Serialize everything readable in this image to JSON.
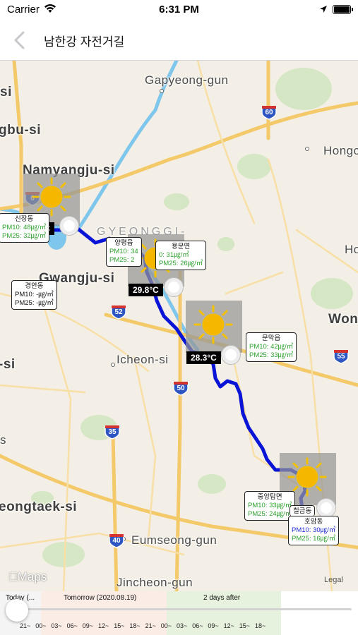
{
  "status_bar": {
    "carrier": "Carrier",
    "time": "6:31 PM"
  },
  "nav": {
    "title": "남한강 자전거길"
  },
  "map": {
    "places": {
      "gapyeong": "Gapyeong-gun",
      "uijeongbu": "gbu-si",
      "hongcheon": "Hongcheo",
      "namyangju": "Namyangju-si",
      "gyeonggi": "GYEONGGI-",
      "gwangju": "Gwangju-si",
      "won": "Won",
      "ho": "Ho",
      "si_left": "-si",
      "icheon": "Icheon-si",
      "pyeongtaek": "eongtaek-si",
      "eumseong": "Eumseong-gun",
      "jincheon": "Jincheon-gun",
      "si_top": "si",
      "s_left": "s"
    },
    "highways": [
      "60",
      "6",
      "52",
      "55",
      "50",
      "35",
      "40"
    ],
    "temps": [
      "29.8°C",
      "28.3°C",
      "°C"
    ],
    "stations": [
      {
        "name": "신장동",
        "pm10": "PM10: 48㎍/㎥",
        "pm25": "PM25: 32㎍/㎥"
      },
      {
        "name": "양평읍",
        "pm10": "PM10: 34",
        "pm25": "PM25: 2"
      },
      {
        "name": "용문면",
        "pm10": "0: 31㎍/㎥",
        "pm25": "PM25: 26㎍/㎥"
      },
      {
        "name": "경안동",
        "pm10": "PM10: -㎍/㎥",
        "pm25": "PM25: -㎍/㎥"
      },
      {
        "name": "문막읍",
        "pm10": "PM10: 42㎍/㎥",
        "pm25": "PM25: 33㎍/㎥"
      },
      {
        "name": "중앙탑면",
        "pm10": "PM10: 33㎍/㎥",
        "pm25": "PM25: 24㎍/㎥"
      },
      {
        "name": "칠금동",
        "pm10": "",
        "pm25": ""
      },
      {
        "name": "호암동",
        "pm10": "PM10: 30㎍/㎥",
        "pm25": "PM25: 16㎍/㎥"
      }
    ],
    "maps_logo": "Maps",
    "legal": "Legal",
    "route_color": "#0a14d6"
  },
  "timeline": {
    "today": "Today (...",
    "tomorrow": "Tomorrow (2020.08.19)",
    "after": "2 days after",
    "ticks": [
      "21~",
      "00~",
      "03~",
      "06~",
      "09~",
      "12~",
      "15~",
      "18~",
      "21~",
      "00~",
      "03~",
      "06~",
      "09~",
      "12~",
      "15~",
      "18~"
    ]
  }
}
